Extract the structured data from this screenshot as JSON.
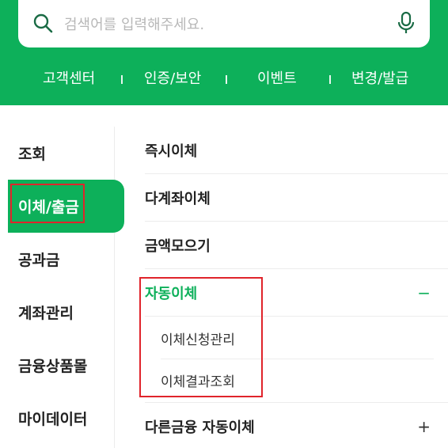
{
  "search": {
    "placeholder": "검색어를 입력해주세요."
  },
  "quick_nav": {
    "items": [
      {
        "label": "고객센터"
      },
      {
        "label": "인증/보안"
      },
      {
        "label": "이벤트"
      },
      {
        "label": "변경/발급"
      }
    ]
  },
  "categories": [
    {
      "label": "조회"
    },
    {
      "label": "이체/출금",
      "active": true
    },
    {
      "label": "공과금"
    },
    {
      "label": "계좌관리"
    },
    {
      "label": "금융상품몰"
    },
    {
      "label": "마이데이터"
    }
  ],
  "menu": {
    "items": [
      {
        "label": "즉시이체"
      },
      {
        "label": "다계좌이체"
      },
      {
        "label": "금액모으기"
      },
      {
        "label": "자동이체",
        "toggle": "−",
        "expanded": true,
        "children": [
          {
            "label": "이체신청관리"
          },
          {
            "label": "이체결과조회"
          }
        ]
      },
      {
        "label": "다른금융 자동이체",
        "toggle": "+"
      }
    ]
  },
  "colors": {
    "brand": "#0db05a",
    "highlight": "#e0242b"
  },
  "icons": {
    "search": "search-icon",
    "mic": "mic-icon"
  }
}
